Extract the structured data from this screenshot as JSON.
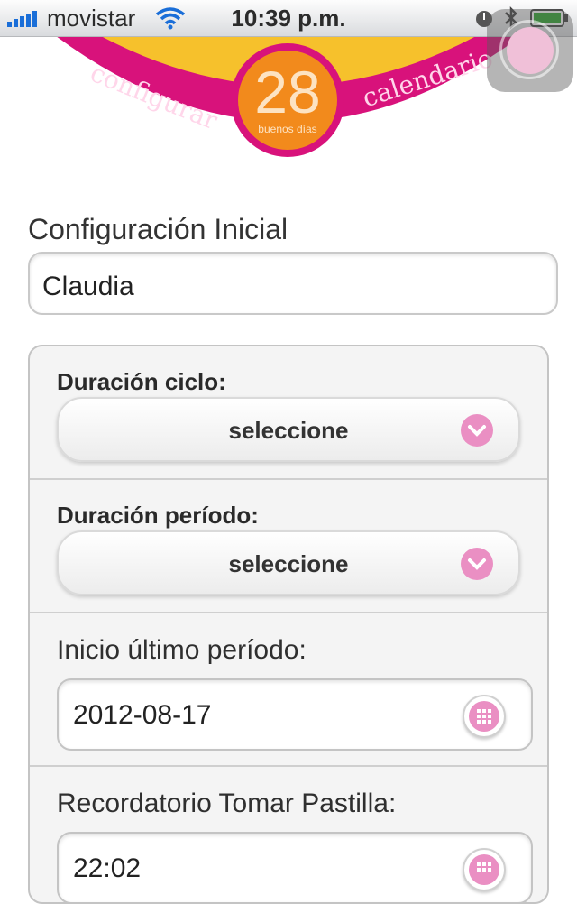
{
  "status_bar": {
    "carrier": "movistar",
    "time": "10:39 p.m."
  },
  "header": {
    "left_text": "configurar",
    "right_text": "calendario",
    "logo_number": "28",
    "logo_subtitle": "buenos días"
  },
  "form": {
    "section_title": "Configuración Inicial",
    "name_value": "Claudia",
    "cycle_label": "Duración ciclo:",
    "cycle_value": "seleccione",
    "period_label": "Duración período:",
    "period_value": "seleccione",
    "last_period_label": "Inicio último período:",
    "last_period_value": "2012-08-17",
    "reminder_label": "Recordatorio Tomar Pastilla:",
    "reminder_value": "22:02"
  },
  "colors": {
    "magenta": "#d8127b",
    "orange": "#f28a1c",
    "yellow": "#f6c12c",
    "accent_pink": "#ea8fc3"
  },
  "icons": [
    "signal-icon",
    "wifi-icon",
    "lock-rotation-icon",
    "bluetooth-icon",
    "battery-icon",
    "chevron-down-icon",
    "calendar-icon",
    "assistive-touch-icon"
  ]
}
